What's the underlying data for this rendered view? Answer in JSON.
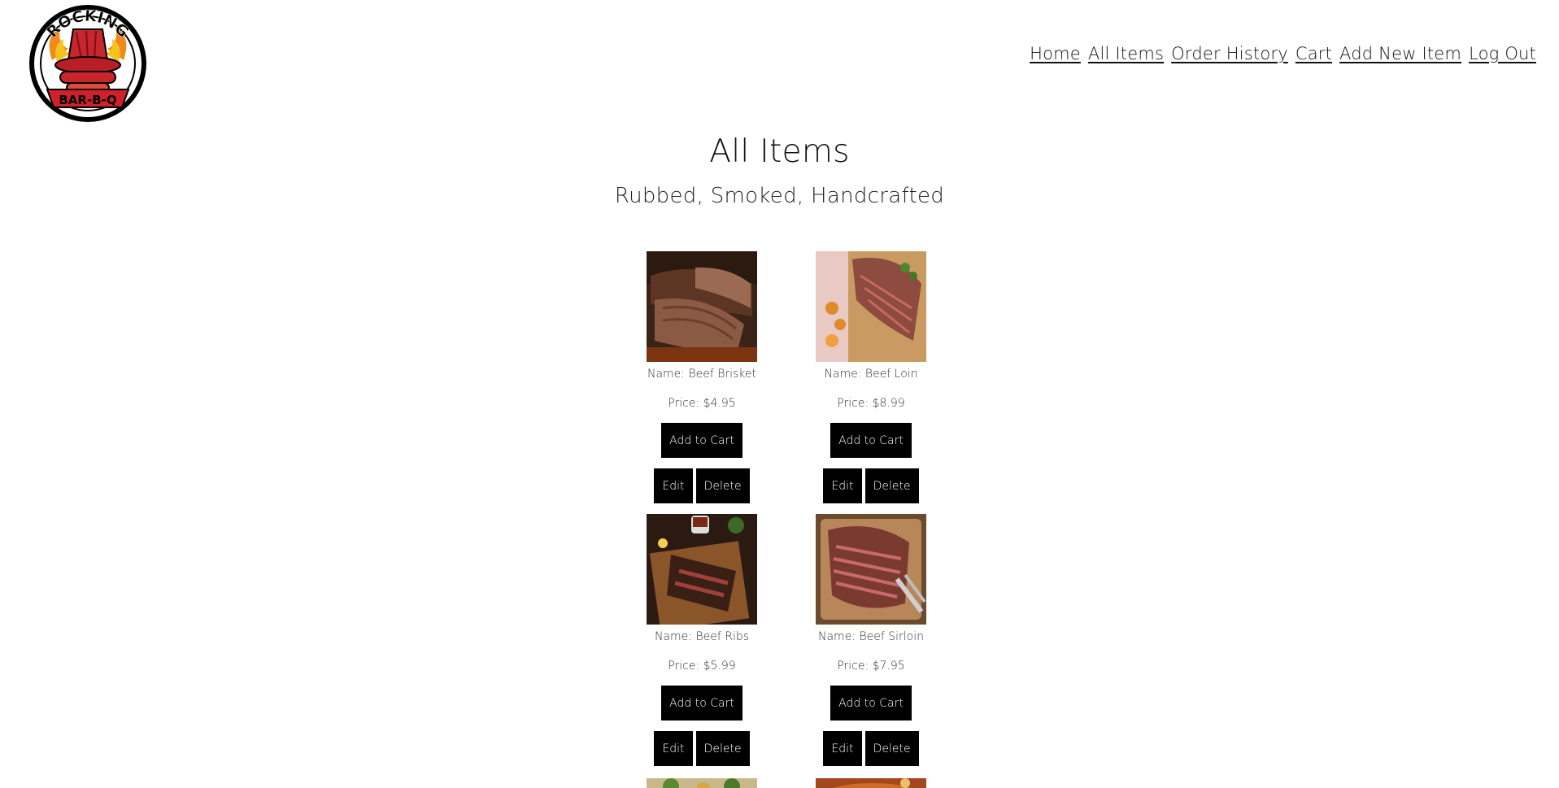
{
  "brand": {
    "logo_text_top": "ROCKING",
    "logo_text_bottom": "BAR-B-Q",
    "accent": "#d0202a"
  },
  "nav": {
    "items": [
      {
        "label": "Home"
      },
      {
        "label": "All Items"
      },
      {
        "label": "Order History"
      },
      {
        "label": "Cart"
      },
      {
        "label": "Add New Item"
      },
      {
        "label": "Log Out"
      }
    ]
  },
  "page": {
    "title": "All Items",
    "subtitle": "Rubbed, Smoked, Handcrafted"
  },
  "products": [
    {
      "name": "Name: Beef Brisket",
      "price": "Price: $4.95",
      "add_label": "Add to Cart",
      "edit_label": "Edit",
      "delete_label": "Delete",
      "image": "brisket-image"
    },
    {
      "name": "Name: Beef Loin",
      "price": "Price: $8.99",
      "add_label": "Add to Cart",
      "edit_label": "Edit",
      "delete_label": "Delete",
      "image": "loin-image"
    },
    {
      "name": "Name: Beef Ribs",
      "price": "Price: $5.99",
      "add_label": "Add to Cart",
      "edit_label": "Edit",
      "delete_label": "Delete",
      "image": "ribs-image"
    },
    {
      "name": "Name: Beef Sirloin",
      "price": "Price: $7.95",
      "add_label": "Add to Cart",
      "edit_label": "Edit",
      "delete_label": "Delete",
      "image": "sirloin-image"
    }
  ]
}
